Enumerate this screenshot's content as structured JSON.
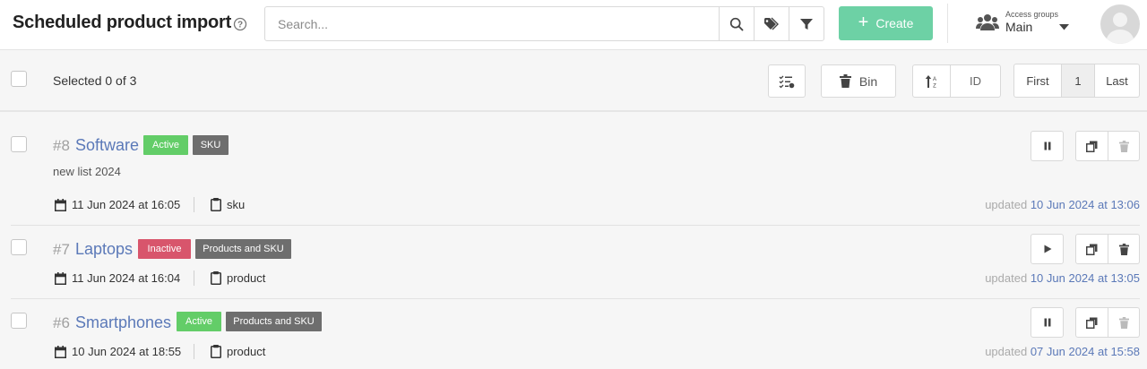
{
  "header": {
    "title": "Scheduled product import",
    "search_placeholder": "Search...",
    "create_label": "Create",
    "access_groups_label": "Access groups",
    "access_groups_value": "Main"
  },
  "toolbar": {
    "selected_text": "Selected 0 of 3",
    "bin_label": "Bin",
    "sort_field": "ID",
    "pagination": {
      "first": "First",
      "current": "1",
      "last": "Last"
    }
  },
  "items": [
    {
      "id": "#8",
      "name": "Software",
      "status": "Active",
      "type": "SKU",
      "description": "new list 2024",
      "date": "11 Jun 2024 at 16:05",
      "field": "sku",
      "updated_label": "updated",
      "updated_date": "10 Jun 2024 at 13:06"
    },
    {
      "id": "#7",
      "name": "Laptops",
      "status": "Inactive",
      "type": "Products and SKU",
      "description": "",
      "date": "11 Jun 2024 at 16:04",
      "field": "product",
      "updated_label": "updated",
      "updated_date": "10 Jun 2024 at 13:05"
    },
    {
      "id": "#6",
      "name": "Smartphones",
      "status": "Active",
      "type": "Products and SKU",
      "description": "",
      "date": "10 Jun 2024 at 18:55",
      "field": "product",
      "updated_label": "updated",
      "updated_date": "07 Jun 2024 at 15:58"
    }
  ],
  "colors": {
    "accent": "#6dd1a5",
    "link": "#5b79b8",
    "active": "#63cd68",
    "inactive": "#d8556c",
    "type_badge": "#6e6e6e"
  },
  "icons": [
    "help-icon",
    "search-icon",
    "tags-icon",
    "filter-icon",
    "plus-icon",
    "users-icon",
    "caret-down-icon",
    "bulk-actions-icon",
    "trash-icon",
    "sort-icon",
    "calendar-icon",
    "clipboard-icon",
    "pause-icon",
    "play-icon",
    "copy-icon"
  ]
}
